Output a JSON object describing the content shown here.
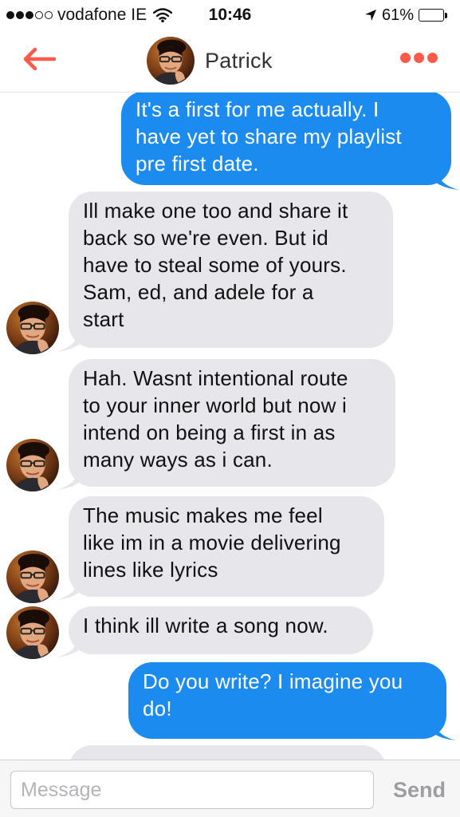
{
  "status_bar": {
    "carrier": "vodafone IE",
    "time": "10:46",
    "battery_percent": "61%",
    "battery_level": 0.61,
    "signal_bars_filled": 3,
    "signal_bars_total": 5
  },
  "header": {
    "contact_name": "Patrick",
    "back_icon": "back-arrow-icon",
    "more_icon": "more-dots-icon",
    "accent_color": "#fd5b49"
  },
  "messages": [
    {
      "direction": "outgoing",
      "text": "It's a first for me actually. I\nhave yet to share my playlist\npre first date."
    },
    {
      "direction": "incoming",
      "text": "Ill make one too and share it\nback so we're even. But id\nhave to steal some of yours.\nSam, ed, and adele for a\nstart"
    },
    {
      "direction": "incoming",
      "text": "Hah. Wasnt intentional route\nto your inner world but now i\nintend on being a first in as\nmany ways as i can."
    },
    {
      "direction": "incoming",
      "text": "The music makes me feel\nlike im in a movie delivering\nlines like lyrics"
    },
    {
      "direction": "incoming",
      "text": "I think ill write a song now."
    },
    {
      "direction": "outgoing",
      "text": "Do you write? I imagine you\ndo!"
    },
    {
      "direction": "incoming",
      "text": ""
    }
  ],
  "composer": {
    "placeholder": "Message",
    "value": "",
    "send_label": "Send"
  },
  "colors": {
    "outgoing_bubble": "#1c8bf0",
    "incoming_bubble": "#e6e6eb",
    "accent": "#fd5b49"
  }
}
